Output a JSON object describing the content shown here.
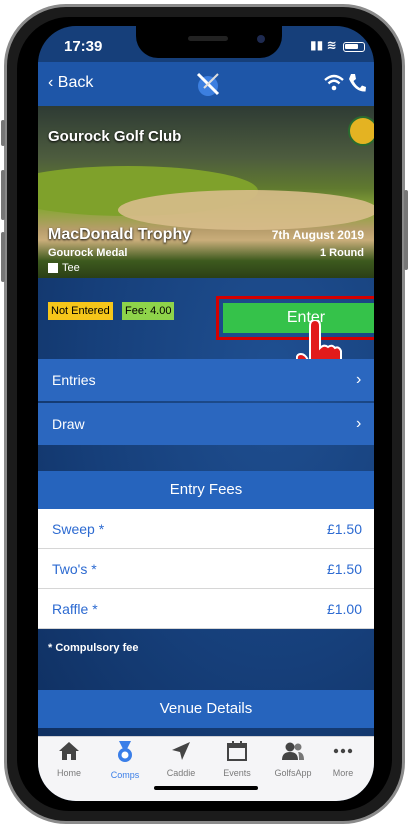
{
  "status_bar": {
    "time": "17:39"
  },
  "nav": {
    "back_label": "Back"
  },
  "event": {
    "club_name": "Gourock Golf Club",
    "title": "MacDonald Trophy",
    "subtitle": "Gourock Medal",
    "tee_label": "Tee",
    "date": "7th August 2019",
    "rounds": "1 Round"
  },
  "status": {
    "entry_status": "Not Entered",
    "fee_label": "Fee: 4.00",
    "enter_button": "Enter"
  },
  "menu": [
    {
      "label": "Entries"
    },
    {
      "label": "Draw"
    }
  ],
  "entry_fees": {
    "header": "Entry Fees",
    "items": [
      {
        "name": "Sweep *",
        "amount": "£1.50"
      },
      {
        "name": "Two's *",
        "amount": "£1.50"
      },
      {
        "name": "Raffle *",
        "amount": "£1.00"
      }
    ],
    "note": "* Compulsory fee"
  },
  "venue": {
    "header": "Venue Details"
  },
  "tabs": [
    {
      "label": "Home",
      "icon": "home-icon"
    },
    {
      "label": "Comps",
      "icon": "medal-icon",
      "active": true
    },
    {
      "label": "Caddie",
      "icon": "location-arrow-icon"
    },
    {
      "label": "Events",
      "icon": "calendar-icon"
    },
    {
      "label": "GolfsApp",
      "icon": "people-icon"
    },
    {
      "label": "More",
      "icon": "more-icon"
    }
  ],
  "colors": {
    "nav_blue": "#1e56a8",
    "row_blue": "#2b67bf",
    "enter_green": "#35c24a",
    "not_entered_yellow": "#f6c61a",
    "fee_green": "#8ed44a",
    "highlight_red": "#d40000",
    "active_tab": "#3a7ee8"
  }
}
